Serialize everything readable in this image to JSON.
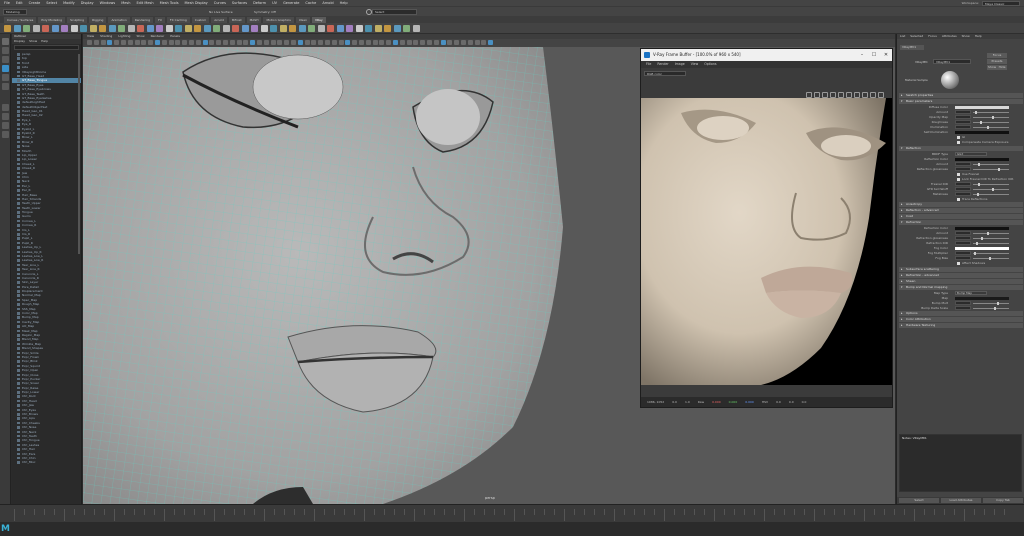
{
  "menubar": {
    "items": [
      "File",
      "Edit",
      "Create",
      "Select",
      "Modify",
      "Display",
      "Windows",
      "Mesh",
      "Edit Mesh",
      "Mesh Tools",
      "Mesh Display",
      "Curves",
      "Surfaces",
      "Deform",
      "UV",
      "Generate",
      "Cache",
      "Arnold",
      "Help"
    ]
  },
  "workspace": {
    "label": "Workspace:",
    "value": "Maya Classic"
  },
  "statusline": {
    "mode": "Modeling",
    "no_live_surface": "No Live Surface",
    "symmetry": "Symmetry: Off",
    "select_field": "Select"
  },
  "shelf_tabs": [
    "Curves / Surfaces",
    "Poly Modeling",
    "Sculpting",
    "Rigging",
    "Animation",
    "Rendering",
    "FX",
    "FX Caching",
    "Custom",
    "Arnold",
    "Bifrost",
    "MASH",
    "Motion Graphics",
    "XGen",
    "VRay"
  ],
  "shelf_active_tab": "VRay",
  "outliner": {
    "title": "Outliner",
    "menu": [
      "Display",
      "Show",
      "Help"
    ],
    "items": [
      "persp",
      "top",
      "front",
      "side",
      "VRayLightDome",
      "GT_Base_Head",
      "GT_Base_Tongue",
      "GT_Base_Eyes",
      "GT_Base_Eyebrows",
      "GT_Base_Teeth",
      "GT_Base_Eyelashes",
      "defaultLightSet",
      "defaultObjectSet",
      "Head_Geo_01",
      "Head_Geo_02",
      "Eye_L",
      "Eye_R",
      "Eyelid_L",
      "Eyelid_R",
      "Brow_L",
      "Brow_R",
      "Nose",
      "Mouth",
      "Lip_Upper",
      "Lip_Lower",
      "Cheek_L",
      "Cheek_R",
      "Jaw",
      "Chin",
      "Neck",
      "Ear_L",
      "Ear_R",
      "Hair_Base",
      "Hair_Strands",
      "Teeth_Upper",
      "Teeth_Lower",
      "Tongue",
      "Gums",
      "Cornea_L",
      "Cornea_R",
      "Iris_L",
      "Iris_R",
      "Pupil_L",
      "Pupil_R",
      "Lashes_Up_L",
      "Lashes_Up_R",
      "Lashes_Low_L",
      "Lashes_Low_R",
      "Tear_Line_L",
      "Tear_Line_R",
      "Caruncle_L",
      "Caruncle_R",
      "Skin_Layer",
      "Pore_Detail",
      "Displacement",
      "Normal_Map",
      "Spec_Map",
      "Rough_Map",
      "SSS_Map",
      "Color_Map",
      "Bump_Map",
      "Cavity_Map",
      "AO_Map",
      "Mask_Map",
      "Region_Map",
      "Blend_Map",
      "Wrinkle_Map",
      "Blend_Shapes",
      "Expr_Smile",
      "Expr_Frown",
      "Expr_Blink",
      "Expr_Squint",
      "Expr_Open",
      "Expr_Close",
      "Expr_Pucker",
      "Expr_Sneer",
      "Expr_Raise",
      "Expr_Lower",
      "Ctrl_Root",
      "Ctrl_Head",
      "Ctrl_Jaw",
      "Ctrl_Eyes",
      "Ctrl_Brows",
      "Ctrl_Lips",
      "Ctrl_Cheeks",
      "Ctrl_Nose",
      "Ctrl_Neck",
      "Ctrl_Teeth",
      "Ctrl_Tongue",
      "Ctrl_Lashes",
      "Ctrl_Hair",
      "Ctrl_Ears",
      "Ctrl_Chin",
      "Ctrl_Misc"
    ],
    "selected_index": 6
  },
  "viewport": {
    "menu": [
      "View",
      "Shading",
      "Lighting",
      "Show",
      "Renderer",
      "Panels"
    ],
    "camera_label": "persp"
  },
  "vfb": {
    "title": "V-Ray Frame Buffer - [100.0% of 960 x 540]",
    "menu": [
      "File",
      "Render",
      "Image",
      "View",
      "Options"
    ],
    "channel": "RGB color",
    "status": [
      "1086, 1052",
      "0.0",
      "1.0",
      "Raw",
      "0.000",
      "0.000",
      "0.000",
      "HSV",
      "0.0",
      "0.0",
      "0.0"
    ]
  },
  "attribute_editor": {
    "tabs": [
      "List",
      "Selected",
      "Focus",
      "Attributes",
      "Show",
      "Help"
    ],
    "node_tab": "VRayMtl1",
    "node_label": "VRayMtl:",
    "node_value": "VRayMtl1",
    "buttons_side": [
      "Focus",
      "Presets",
      "Show",
      "Hide"
    ],
    "sample_label": "Material Sample",
    "sections": [
      {
        "label": "Swatch properties",
        "open": false
      },
      {
        "label": "Basic parameters",
        "open": true
      },
      {
        "label": "Reflection",
        "open": true
      },
      {
        "label": "Anisotropy",
        "open": false
      },
      {
        "label": "Reflection - advanced",
        "open": false
      },
      {
        "label": "Coat",
        "open": false
      },
      {
        "label": "Refraction",
        "open": true
      },
      {
        "label": "Subsurface scattering",
        "open": false
      },
      {
        "label": "Refraction - advanced",
        "open": false
      },
      {
        "label": "Sheen",
        "open": false
      },
      {
        "label": "Bump and Normal mapping",
        "open": true
      },
      {
        "label": "Options",
        "open": false
      },
      {
        "label": "Color Attribution",
        "open": false
      },
      {
        "label": "Hardware Texturing",
        "open": false
      }
    ],
    "basic_rows": [
      "Diffuse Color",
      "Amount",
      "Opacity Map",
      "Roughness",
      "Illumination",
      "Self-Illumination",
      "GI",
      "Compensate Camera Exposure"
    ],
    "refl_rows": [
      "BRDF Type",
      "Reflection Color",
      "Amount",
      "Reflection glossiness",
      "Use Fresnel",
      "Lock Fresnel IOR To Refraction IOR",
      "Fresnel IOR",
      "GTR tail falloff",
      "Metalness",
      "Trace Reflections"
    ],
    "brdf_value": "GGX",
    "refr_rows": [
      "Refraction Color",
      "Amount",
      "Refraction glossiness",
      "Refraction IOR",
      "Fog Color",
      "Fog Multiplier",
      "Fog Bias",
      "Affect Shadows"
    ],
    "bump_rows": [
      "Map Type",
      "Map",
      "Bump Mult",
      "Bump Delta Scale"
    ],
    "bump_type": "Bump Map",
    "notes_label": "Notes: VRayMtl1",
    "bottom_buttons": [
      "Select",
      "Load Attributes",
      "Copy Tab"
    ]
  }
}
